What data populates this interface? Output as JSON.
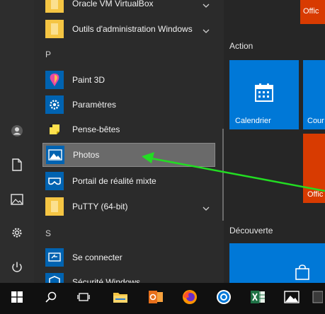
{
  "apps": {
    "virtualbox": "Oracle VM VirtualBox",
    "outils": "Outils d'administration Windows",
    "letter_p": "P",
    "paint3d": "Paint 3D",
    "parametres": "Paramètres",
    "pensebetes": "Pense-bêtes",
    "photos": "Photos",
    "portail": "Portail de réalité mixte",
    "putty": "PuTTY (64-bit)",
    "letter_s": "S",
    "seconnecter": "Se connecter",
    "securite": "Sécurité Windows"
  },
  "tiles": {
    "top_partial": "Offic",
    "action_title": "Action",
    "calendrier": "Calendrier",
    "cour": "Cour",
    "offic2": "Offic",
    "decouverte_title": "Découverte"
  },
  "colors": {
    "tile_blue": "#0078d7",
    "tile_orange": "#d83b01",
    "selection": "#6a6a6a",
    "arrow": "#22dd22"
  },
  "icons": {
    "rail": [
      "user-icon",
      "document-icon",
      "pictures-icon",
      "settings-icon",
      "power-icon"
    ],
    "taskbar": [
      "windows-start-icon",
      "search-icon",
      "task-view-icon",
      "file-explorer-icon",
      "outlook-icon",
      "firefox-icon",
      "app-blue-circle-icon",
      "excel-icon",
      "photos-icon",
      "app-icon"
    ]
  }
}
